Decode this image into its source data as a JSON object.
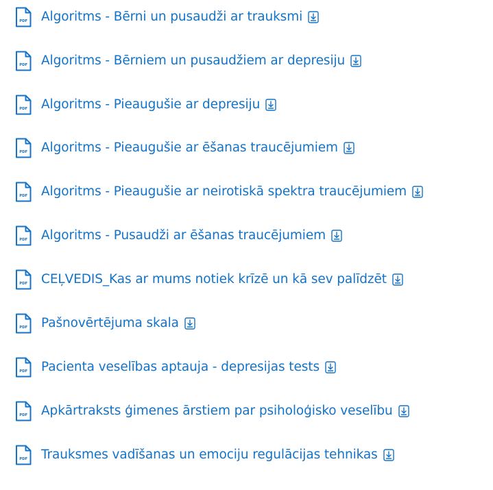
{
  "icons": {
    "file": "pdf-file-icon",
    "file_badge": "PDF",
    "download": "download-icon"
  },
  "colors": {
    "link": "#1373c8",
    "icon": "#1373c8"
  },
  "documents": [
    {
      "title": "Algoritms - Bērni un pusaudži ar trauksmi"
    },
    {
      "title": "Algoritms - Bērniem un pusaudžiem ar depresiju"
    },
    {
      "title": "Algoritms - Pieaugušie ar depresiju"
    },
    {
      "title": "Algoritms - Pieaugušie ar ēšanas traucējumiem"
    },
    {
      "title": "Algoritms - Pieaugušie ar neirotiskā spektra traucējumiem"
    },
    {
      "title": "Algoritms - Pusaudži ar ēšanas traucējumiem"
    },
    {
      "title": "CEĻVEDIS_Kas ar mums notiek krīzē un kā sev palīdzēt"
    },
    {
      "title": "Pašnovērtējuma skala"
    },
    {
      "title": "Pacienta veselības aptauja - depresijas tests"
    },
    {
      "title": "Apkārtraksts ģimenes ārstiem par psiholoģisko veselību"
    },
    {
      "title": "Trauksmes vadīšanas un emociju regulācijas tehnikas"
    }
  ]
}
